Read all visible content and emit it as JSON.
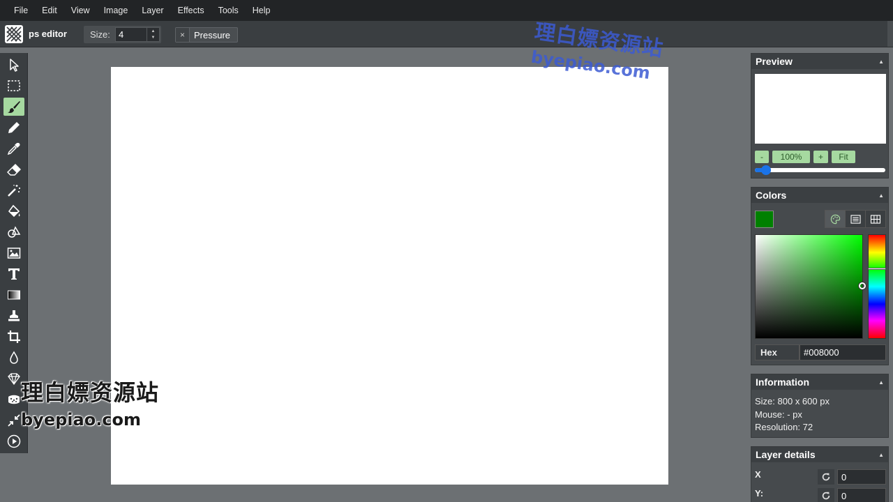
{
  "menubar": {
    "items": [
      "File",
      "Edit",
      "View",
      "Image",
      "Layer",
      "Effects",
      "Tools",
      "Help"
    ]
  },
  "toolbar": {
    "logo_icon": "miniPaint-logo-icon",
    "app_name": "ps editor",
    "size_label": "Size:",
    "size_value": "4",
    "pressure_close": "×",
    "pressure_label": "Pressure"
  },
  "tools": [
    {
      "name": "select",
      "icon": "cursor-icon",
      "active": false
    },
    {
      "name": "selection",
      "icon": "marquee-icon",
      "active": false
    },
    {
      "name": "brush",
      "icon": "brush-icon",
      "active": true
    },
    {
      "name": "pencil",
      "icon": "pencil-icon",
      "active": false
    },
    {
      "name": "pick-color",
      "icon": "eyedropper-icon",
      "active": false
    },
    {
      "name": "erase",
      "icon": "eraser-icon",
      "active": false
    },
    {
      "name": "magic-wand",
      "icon": "magic-wand-icon",
      "active": false
    },
    {
      "name": "fill",
      "icon": "paint-bucket-icon",
      "active": false
    },
    {
      "name": "shape",
      "icon": "shapes-icon",
      "active": false
    },
    {
      "name": "media",
      "icon": "image-icon",
      "active": false
    },
    {
      "name": "text",
      "icon": "text-icon",
      "active": false
    },
    {
      "name": "gradient",
      "icon": "gradient-icon",
      "active": false
    },
    {
      "name": "clone",
      "icon": "stamp-icon",
      "active": false
    },
    {
      "name": "crop",
      "icon": "crop-icon",
      "active": false
    },
    {
      "name": "blur",
      "icon": "drop-icon",
      "active": false
    },
    {
      "name": "sharpen",
      "icon": "diamond-icon",
      "active": false
    },
    {
      "name": "bulge-pinch",
      "icon": "sponge-icon",
      "active": false
    },
    {
      "name": "desaturate",
      "icon": "shrink-arrows-icon",
      "active": false
    },
    {
      "name": "animation",
      "icon": "play-icon",
      "active": false
    }
  ],
  "preview": {
    "title": "Preview",
    "zoom_out": "-",
    "zoom_value": "100%",
    "zoom_in": "+",
    "fit": "Fit",
    "slider_level": 0.05
  },
  "colors": {
    "title": "Colors",
    "current": "#008000",
    "hex_label": "Hex",
    "hex_value": "#008000",
    "modes": [
      "palette-icon",
      "list-icon",
      "grid-icon"
    ]
  },
  "information": {
    "title": "Information",
    "size": "Size: 800 x 600 px",
    "mouse": "Mouse: - px",
    "resolution": "Resolution: 72"
  },
  "layer_details": {
    "title": "Layer details",
    "x_label": "X",
    "x_value": "0",
    "y_label": "Y:",
    "y_value": "0"
  },
  "watermark": {
    "cn": "理白嫖资源站",
    "en": "byepiao.com"
  }
}
